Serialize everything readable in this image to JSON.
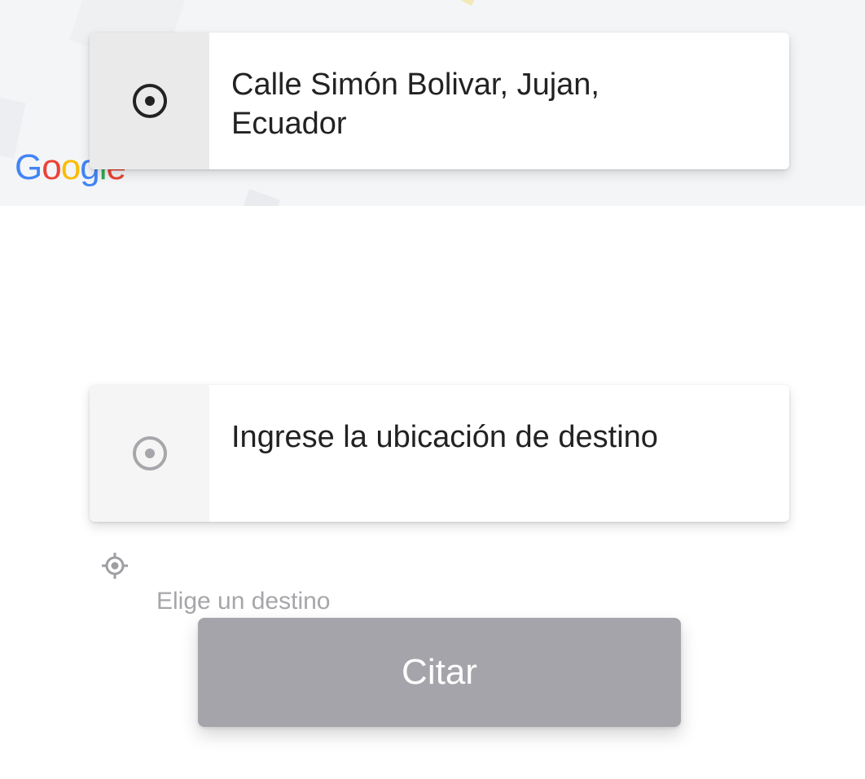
{
  "map": {
    "attribution": "Google"
  },
  "origin": {
    "icon": "radio-target-icon",
    "address": "Calle Simón Bolivar, Jujan, Ecuador"
  },
  "destination": {
    "icon": "radio-target-icon",
    "placeholder": "Ingrese la ubicación de destino"
  },
  "locate": {
    "icon": "locate-crosshair-icon"
  },
  "hint": {
    "text": "Elige un destino"
  },
  "action": {
    "label": "Citar",
    "enabled": false
  },
  "colors": {
    "button_disabled": "#a4a4aa",
    "text_primary": "#222222",
    "text_hint": "#a6a6aa",
    "icon_inactive": "#a7a7ab"
  }
}
